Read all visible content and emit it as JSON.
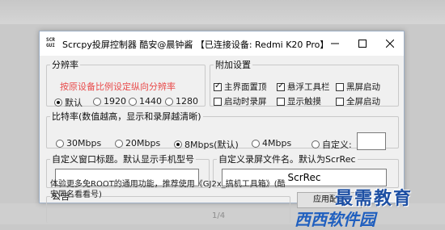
{
  "window": {
    "title": "Scrcpy投屏控制器 酷安@晨钟酱 【已连接设备: Redmi K20 Pro】",
    "app_icon": "scrcpy-gui-icon"
  },
  "resolution": {
    "legend": "分辨率",
    "hint": "按原设备比例设定纵向分辨率",
    "options": [
      {
        "label": "默认",
        "checked": true
      },
      {
        "label": "1920",
        "checked": false
      },
      {
        "label": "1440",
        "checked": false
      },
      {
        "label": "1280",
        "checked": false
      }
    ]
  },
  "extras": {
    "legend": "附加设置",
    "options": [
      {
        "label": "主界面置顶",
        "checked": true
      },
      {
        "label": "悬浮工具栏",
        "checked": true
      },
      {
        "label": "黑屏启动",
        "checked": false
      },
      {
        "label": "启动时录屏",
        "checked": false
      },
      {
        "label": "显示触摸",
        "checked": false
      },
      {
        "label": "全屏启动",
        "checked": false
      }
    ]
  },
  "bitrate": {
    "legend": "比特率(数值越高，显示和录屏越清晰)",
    "options": [
      {
        "label": "30Mbps",
        "checked": false
      },
      {
        "label": "20Mbps",
        "checked": false
      },
      {
        "label": "8Mbps(默认)",
        "checked": true
      },
      {
        "label": "4Mbps",
        "checked": false
      },
      {
        "label": "自定义:",
        "checked": false
      }
    ],
    "custom_value": ""
  },
  "window_title_box": {
    "legend": "自定义窗口标题。默认显示手机型号",
    "value": ""
  },
  "record_name_box": {
    "legend": "自定义录屏文件名。默认为ScrRec",
    "value": "ScrRec"
  },
  "announcement": {
    "legend": "公告",
    "text": "体验更多免ROOT的通用功能，推荐使用《GJ2x_搞机工具箱》(酷安同名看看号)"
  },
  "apply_button": "应用配置",
  "page_indicator": "1/4",
  "watermark": "最需教育",
  "bottom_logo": "西西软件园"
}
